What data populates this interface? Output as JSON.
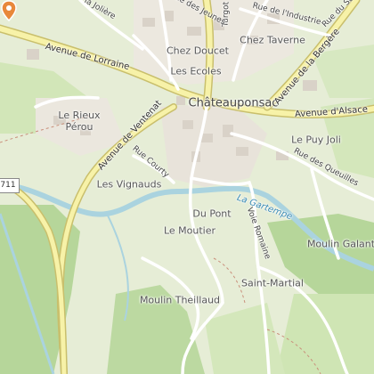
{
  "map": {
    "places": [
      {
        "id": "chateauponsac",
        "text": "Châteauponsac"
      },
      {
        "id": "chez-doucet",
        "text": "Chez Doucet"
      },
      {
        "id": "chez-taverne",
        "text": "Chez Taverne"
      },
      {
        "id": "les-ecoles",
        "text": "Les Ecoles"
      },
      {
        "id": "le-rieux-perou",
        "text": "Le Rieux\nPérou"
      },
      {
        "id": "le-puy-joli",
        "text": "Le Puy Joli"
      },
      {
        "id": "les-vignauds",
        "text": "Les Vignauds"
      },
      {
        "id": "du-pont",
        "text": "Du Pont"
      },
      {
        "id": "le-moutier",
        "text": "Le Moutier"
      },
      {
        "id": "moulin-galant",
        "text": "Moulin Galant"
      },
      {
        "id": "saint-martial",
        "text": "Saint-Martial"
      },
      {
        "id": "moulin-theillaud",
        "text": "Moulin Theillaud"
      }
    ],
    "roads": [
      {
        "id": "avenue-de-lorraine",
        "text": "Avenue de Lorraine"
      },
      {
        "id": "avenue-dalsace",
        "text": "Avenue d'Alsace"
      },
      {
        "id": "avenue-de-la-bergere",
        "text": "Avenue de la Bergère"
      },
      {
        "id": "avenue-de-ventenat",
        "text": "Avenue de Ventenat"
      },
      {
        "id": "turgot",
        "text": "Turgot"
      },
      {
        "id": "rue-des-jeunes",
        "text": "Rue des Jeunes"
      },
      {
        "id": "rue-de-lindustrie",
        "text": "Rue de l'Industrie"
      },
      {
        "id": "rue-courty",
        "text": "Rue Courty"
      },
      {
        "id": "rue-des-queuilles",
        "text": "Rue des Queuilles"
      },
      {
        "id": "voie-romaine",
        "text": "Voie Romaine"
      },
      {
        "id": "la-joliere",
        "text": "la Jolière"
      },
      {
        "id": "rue-du-stade",
        "text": "Rue du Stade"
      }
    ],
    "river": "La Gartempe",
    "route_shield": "711",
    "marker_icon": "location-pin-icon",
    "colors": {
      "background": "#e6edd6",
      "meadow": "#cfe5b4",
      "forest": "#b6d69a",
      "water": "#aad3df",
      "main_road": "#f7f2a8",
      "main_road_casing": "#c9bf6c",
      "minor_road": "#ffffff",
      "building": "#d9d2c8",
      "marker": "#e8883a"
    }
  }
}
